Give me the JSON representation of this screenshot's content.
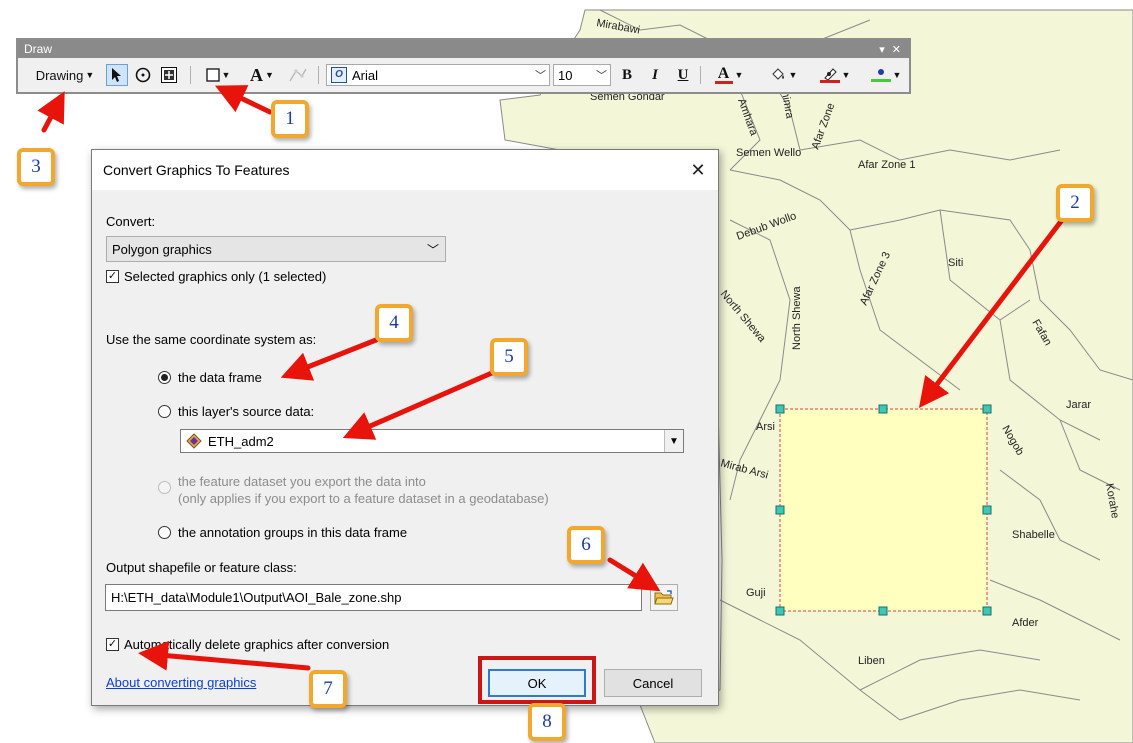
{
  "map": {
    "labels": [
      "Mirabawi",
      "Semen Gondar",
      "Amhara",
      "Waghimra",
      "Afar Zone",
      "Semen Wello",
      "Afar Zone 1",
      "Debub Wollo",
      "Afar Zone 3",
      "Siti",
      "North Shewa",
      "North Shewa",
      "Fafan",
      "Jarar",
      "Arsi",
      "Mirab Arsi",
      "Nogob",
      "Korahe",
      "Shabelle",
      "Guji",
      "Afder",
      "Liben"
    ],
    "graphic_fill": "#ffffc0"
  },
  "toolbar": {
    "title": "Draw",
    "title_controls": "▾ ✕",
    "drawing_label": "Drawing",
    "font_name": "Arial",
    "font_size": "10",
    "bold": "B",
    "italic": "I",
    "underline": "U",
    "text_tool": "A",
    "font_color_letter": "A",
    "font_color": "#d41f1f",
    "line_color": "#d41f1f",
    "marker_color": "#49c93a"
  },
  "dialog": {
    "title": "Convert Graphics To Features",
    "convert_label": "Convert:",
    "convert_value": "Polygon graphics",
    "selected_only": "Selected graphics only  (1 selected)",
    "coord_label": "Use the same coordinate system as:",
    "opt_data_frame": "the data frame",
    "opt_layer_source": "this layer's source data:",
    "layer_value": "ETH_adm2",
    "opt_feature_dataset_line1": "the feature dataset you export the data into",
    "opt_feature_dataset_line2": "(only applies if you export to a feature dataset in a geodatabase)",
    "opt_annotation": "the annotation groups in this data frame",
    "output_label": "Output shapefile or feature class:",
    "output_value": "H:\\ETH_data\\Module1\\Output\\AOI_Bale_zone.shp",
    "auto_delete": "Automatically delete graphics after conversion",
    "about_link": "About converting graphics",
    "ok": "OK",
    "cancel": "Cancel"
  },
  "callouts": [
    "1",
    "2",
    "3",
    "4",
    "5",
    "6",
    "7",
    "8"
  ],
  "accent": {
    "callout_border": "#f2a72e",
    "arrow": "#e8140c",
    "ok_highlight": "#cc1616"
  }
}
